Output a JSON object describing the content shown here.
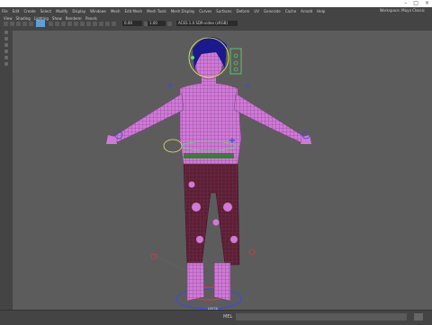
{
  "window": {
    "title_right": "Viewport 2.0",
    "controls": [
      "–",
      "□",
      "×"
    ]
  },
  "menus": [
    "File",
    "Edit",
    "Create",
    "Select",
    "Modify",
    "Display",
    "Windows",
    "Mesh",
    "Edit Mesh",
    "Mesh Tools",
    "Mesh Display",
    "Curves",
    "Surfaces",
    "Deform",
    "UV",
    "Generate",
    "Cache",
    "Arnold",
    "Help"
  ],
  "workspace": "Workspace: Maya Classic",
  "status": {
    "field1": "0.00",
    "field2": "1.00",
    "colorspace": "ACES 1.0 SDR-video (sRGB)"
  },
  "panel_menu": [
    "View",
    "Shading",
    "Lighting",
    "Show",
    "Renderer",
    "Panels"
  ],
  "viewport": {
    "camera_label": "persp"
  },
  "command_line": {
    "label": "MEL"
  },
  "colors": {
    "viewport_bg": "#5c5c5c",
    "mesh": "#d07ad7",
    "wire": "#7a3c83",
    "control_blue": "#3a4fd0",
    "control_yellow": "#e8e85a",
    "control_green": "#5ce06a",
    "control_red": "#d53b3b"
  }
}
